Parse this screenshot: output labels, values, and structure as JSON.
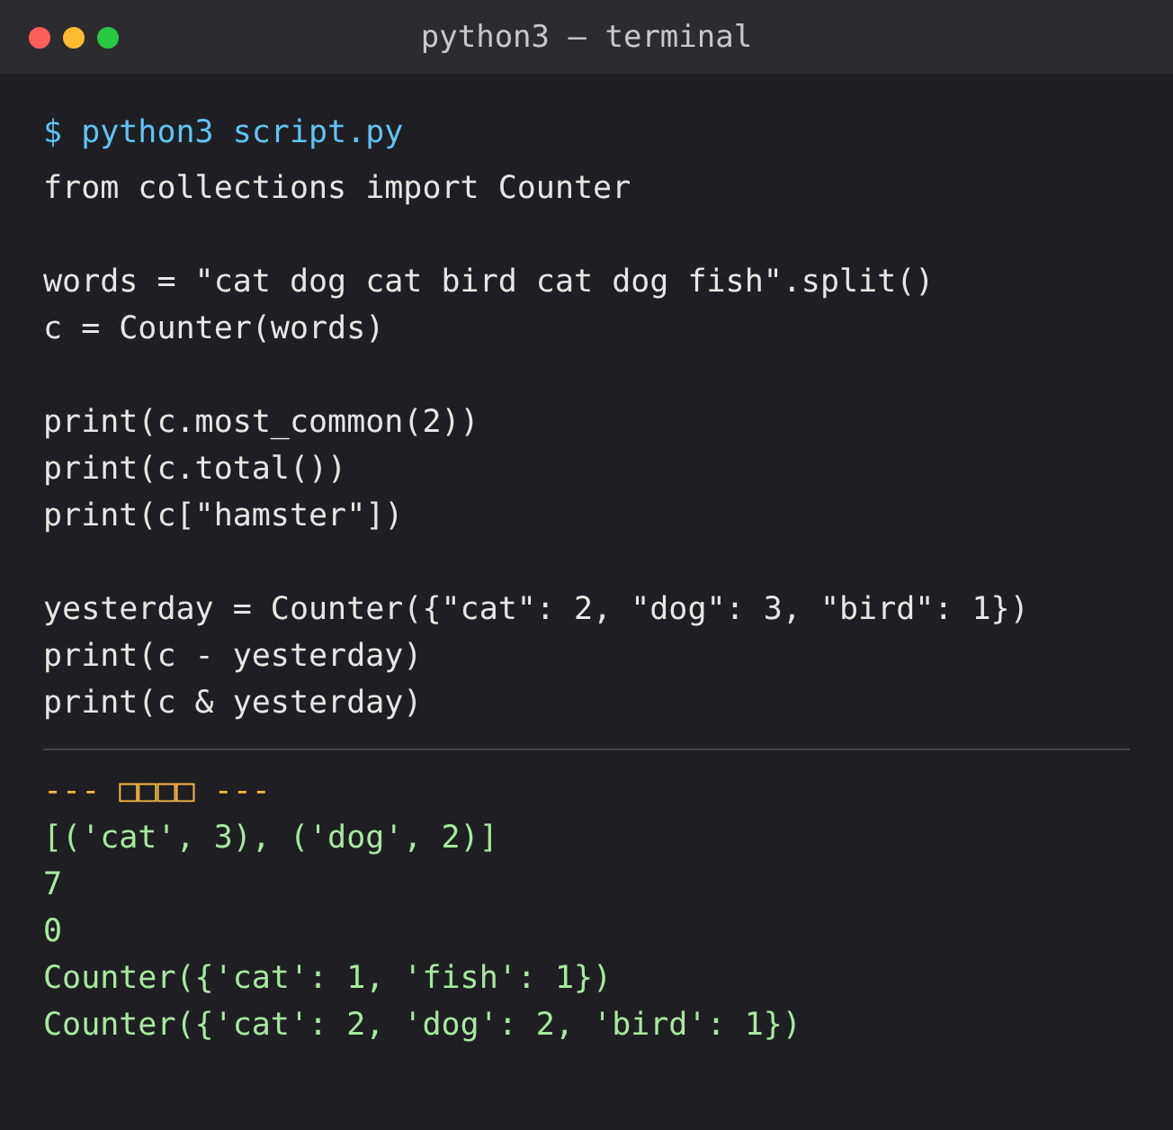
{
  "window": {
    "title": "python3 — terminal"
  },
  "prompt": {
    "symbol": "$",
    "command": "python3 script.py"
  },
  "code_blocks": [
    [
      "from collections import Counter"
    ],
    [
      "words = \"cat dog cat bird cat dog fish\".split()",
      "c = Counter(words)"
    ],
    [
      "print(c.most_common(2))",
      "print(c.total())",
      "print(c[\"hamster\"])"
    ],
    [
      "yesterday = Counter({\"cat\": 2, \"dog\": 3, \"bird\": 1})",
      "print(c - yesterday)",
      "print(c & yesterday)"
    ]
  ],
  "output": {
    "header": "--- □□□□ ---",
    "lines": [
      "[('cat', 3), ('dog', 2)]",
      "7",
      "0",
      "Counter({'cat': 1, 'fish': 1})",
      "Counter({'cat': 2, 'dog': 2, 'bird': 1})"
    ]
  }
}
